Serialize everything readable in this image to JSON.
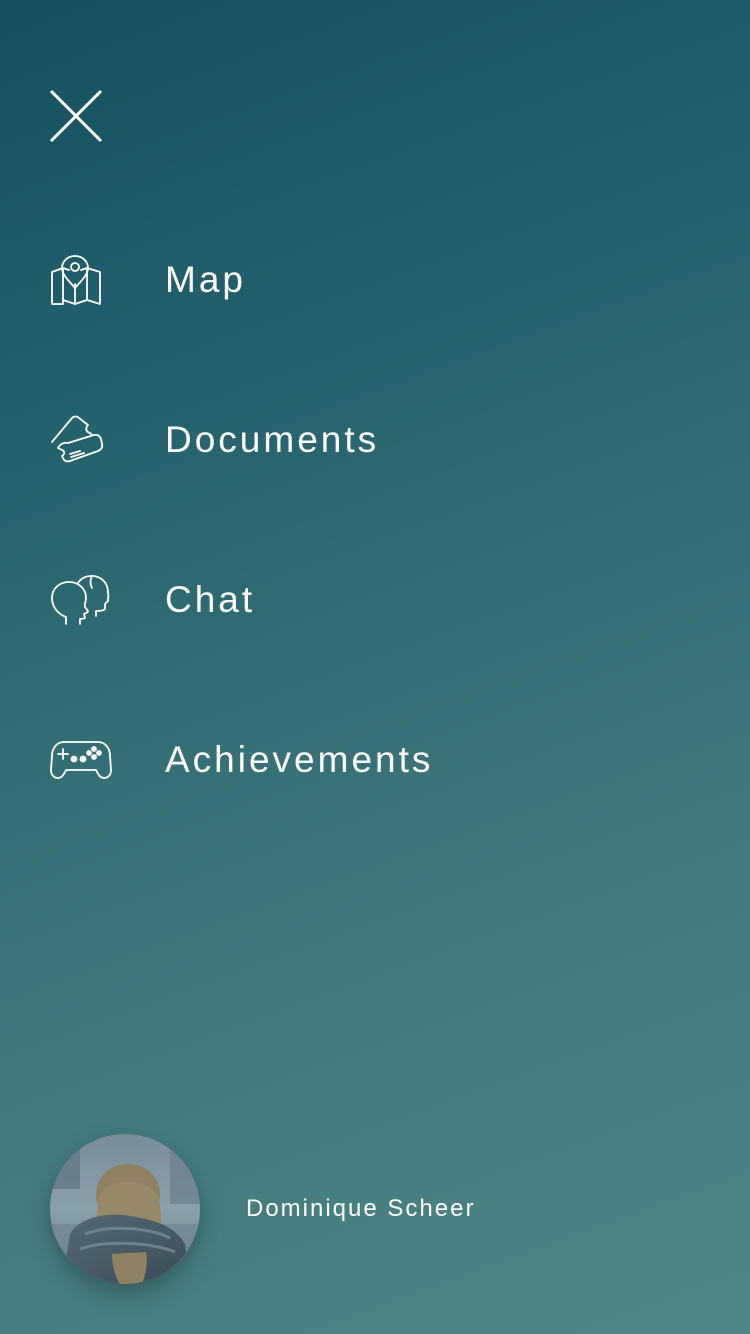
{
  "menu": {
    "close_icon": "close-icon",
    "items": [
      {
        "label": "Map",
        "icon": "map-pin-icon"
      },
      {
        "label": "Documents",
        "icon": "tickets-icon"
      },
      {
        "label": "Chat",
        "icon": "people-heads-icon"
      },
      {
        "label": "Achievements",
        "icon": "gamepad-icon"
      }
    ]
  },
  "profile": {
    "name": "Dominique Scheer",
    "avatar_icon": "avatar-photo"
  },
  "colors": {
    "background_top": "#174f5f",
    "background_bottom": "#4f8584",
    "text": "#ffffff"
  }
}
